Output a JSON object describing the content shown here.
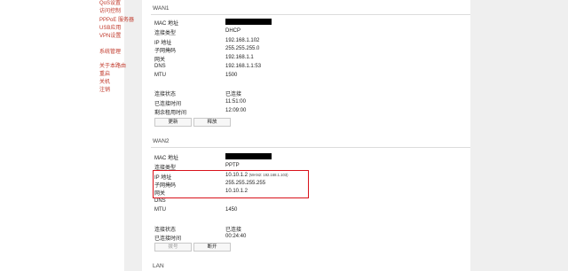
{
  "sidebar": {
    "items": [
      {
        "label": "QoS设置"
      },
      {
        "label": "访问控制"
      },
      {
        "label": "PPPoE 服务器"
      },
      {
        "label": "USB应用"
      },
      {
        "label": "VPN设置"
      },
      {
        "label": "系统管理"
      },
      {
        "label": "关于本路由"
      },
      {
        "label": "重启"
      },
      {
        "label": "关机"
      },
      {
        "label": "注销"
      }
    ]
  },
  "wan1": {
    "title": "WAN1",
    "rows": [
      {
        "label": "MAC 地址",
        "value": ""
      },
      {
        "label": "连接类型",
        "value": "DHCP"
      },
      {
        "label": "IP 地址",
        "value": "192.168.1.102"
      },
      {
        "label": "子网掩码",
        "value": "255.255.255.0"
      },
      {
        "label": "网关",
        "value": "192.168.1.1"
      },
      {
        "label": "DNS",
        "value": "192.168.1.1:53"
      },
      {
        "label": "MTU",
        "value": "1500"
      }
    ],
    "status_rows": [
      {
        "label": "连接状态",
        "value": "已连接"
      },
      {
        "label": "已连接时间",
        "value": "11:51:00"
      },
      {
        "label": "剩余租用时间",
        "value": "12:09:00"
      }
    ],
    "buttons": {
      "renew": "更新",
      "release": "释放"
    }
  },
  "wan2": {
    "title": "WAN2",
    "rows": [
      {
        "label": "MAC 地址",
        "value": ""
      },
      {
        "label": "连接类型",
        "value": "PPTP"
      },
      {
        "label": "IP 地址",
        "value": "10.10.1.2",
        "note": "(WAN2: 192.168.1.103)"
      },
      {
        "label": "子网掩码",
        "value": "255.255.255.255"
      },
      {
        "label": "网关",
        "value": "10.10.1.2"
      },
      {
        "label": "DNS",
        "value": ""
      },
      {
        "label": "MTU",
        "value": "1450"
      }
    ],
    "status_rows": [
      {
        "label": "连接状态",
        "value": "已连接"
      },
      {
        "label": "已连接时间",
        "value": "00:24:40"
      }
    ],
    "buttons": {
      "connect": "拨号",
      "disconnect": "断开"
    }
  },
  "lan": {
    "title": "LAN"
  },
  "colors": {
    "link": "#c0392b",
    "highlight": "#d9121b"
  }
}
